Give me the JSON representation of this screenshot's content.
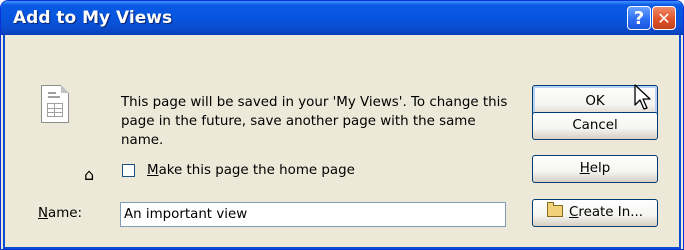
{
  "window": {
    "title": "Add to My Views"
  },
  "titlebar": {
    "help_glyph": "?",
    "close_glyph": "✕"
  },
  "message": "This page will be saved in your 'My Views'. To change this page in the future, save another page with the same name.",
  "home_checkbox": {
    "label_underlined": "M",
    "label_rest": "ake this page the home page",
    "checked": false
  },
  "name_field": {
    "label_underlined": "N",
    "label_rest": "ame:",
    "value": "An important view"
  },
  "buttons": {
    "ok": "OK",
    "cancel": "Cancel",
    "help_underlined": "H",
    "help_rest": "elp",
    "create_underlined": "C",
    "create_rest": "reate In..."
  },
  "icons": [
    "document-icon",
    "home-icon",
    "folder-icon",
    "mouse-cursor-icon",
    "help-icon",
    "close-icon"
  ],
  "colors": {
    "titlebar": "#0a5ae5",
    "dialog_bg": "#ece9d8",
    "close_button": "#e0532a"
  }
}
